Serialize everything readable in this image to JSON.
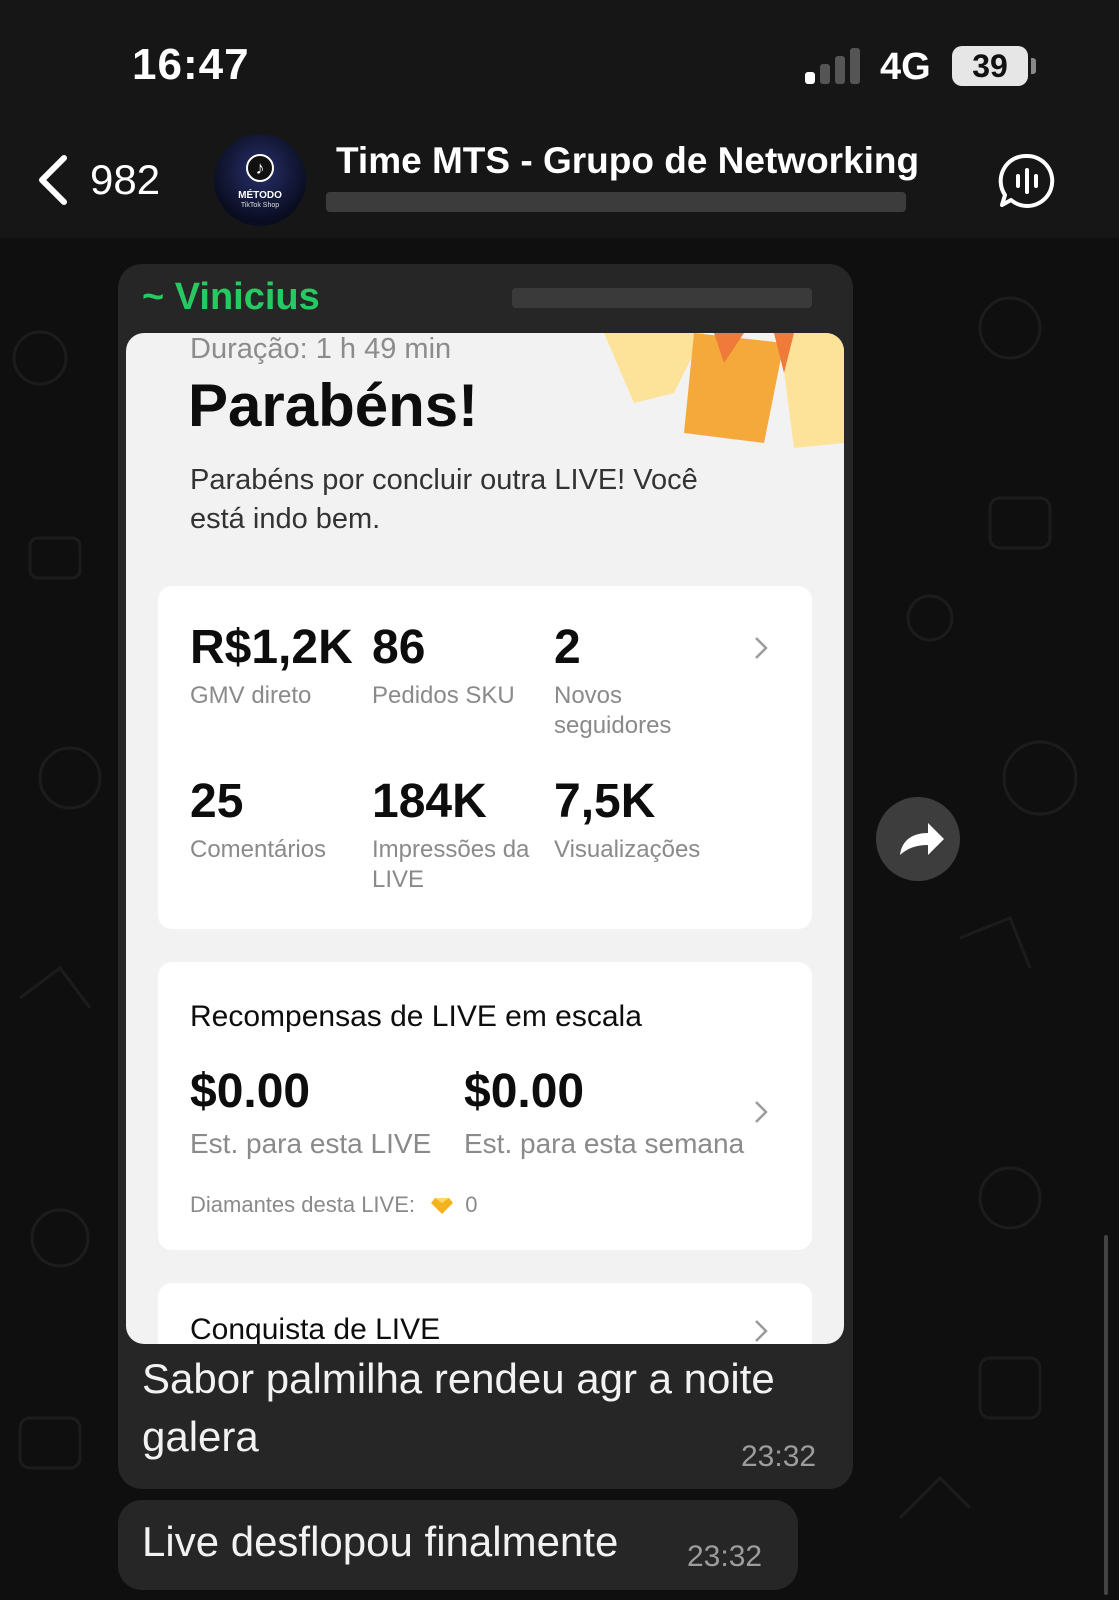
{
  "status_bar": {
    "time": "16:47",
    "network": "4G",
    "battery": "39"
  },
  "header": {
    "back_count": "982",
    "group_name": "Time MTS - Grupo de Networking",
    "avatar_logo_line1": "MÉTODO",
    "avatar_logo_line2": "TikTok Shop"
  },
  "message1": {
    "sender": "~ Vinicius",
    "caption": "Sabor palmilha rendeu agr a noite galera",
    "time": "23:32",
    "image": {
      "duration": "Duração: 1 h 49 min",
      "headline": "Parabéns!",
      "message": "Parabéns por concluir outra LIVE! Você está indo bem.",
      "stats": [
        {
          "value": "R$1,2K",
          "label": "GMV direto"
        },
        {
          "value": "86",
          "label": "Pedidos SKU"
        },
        {
          "value": "2",
          "label": "Novos seguidores"
        },
        {
          "value": "25",
          "label": "Comentários"
        },
        {
          "value": "184K",
          "label": "Impressões da LIVE"
        },
        {
          "value": "7,5K",
          "label": "Visualizações"
        }
      ],
      "rewards": {
        "title": "Recompensas de LIVE em escala",
        "live_value": "$0.00",
        "live_label": "Est. para esta LIVE",
        "week_value": "$0.00",
        "week_label": "Est. para esta semana",
        "diamonds_label": "Diamantes desta LIVE:",
        "diamonds_value": "0"
      },
      "achievement_title": "Conquista de LIVE"
    }
  },
  "message2": {
    "caption": "Live desflopou finalmente",
    "time": "23:32"
  },
  "colors": {
    "sender": "#27c962",
    "bubble": "#262626",
    "header_bg": "#161616"
  }
}
